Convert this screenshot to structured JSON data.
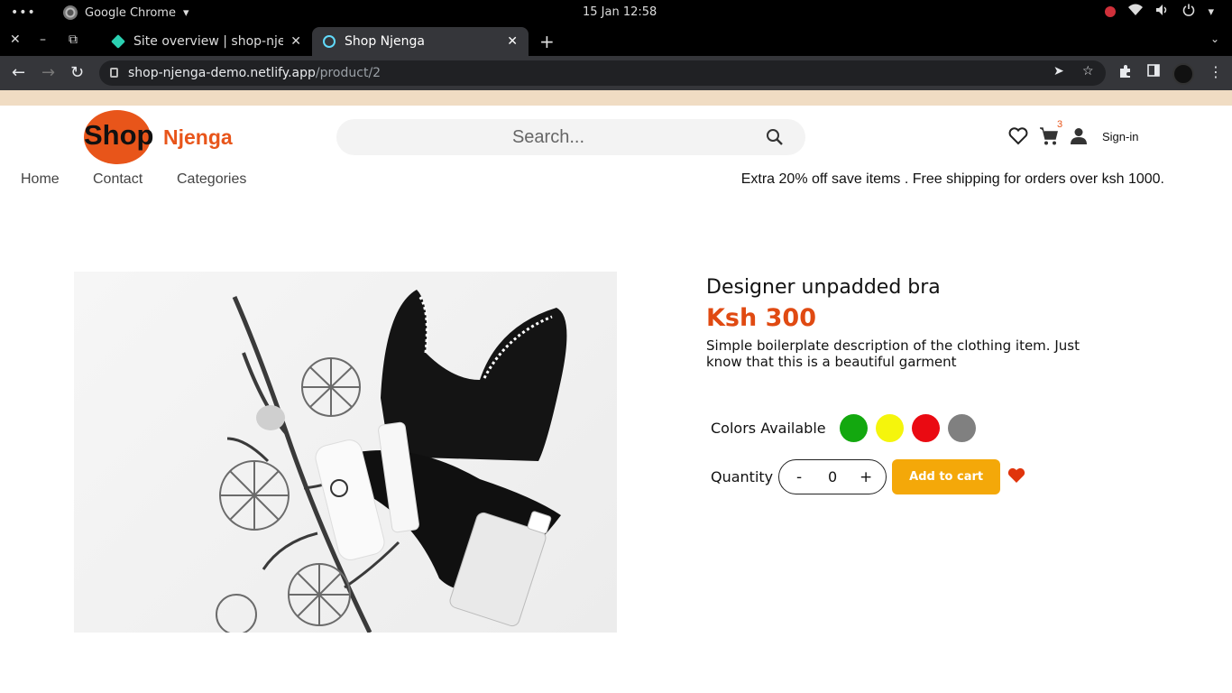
{
  "os": {
    "app_name": "Google Chrome",
    "clock": "15 Jan  12:58"
  },
  "browser": {
    "tabs": [
      {
        "title": "Site overview | shop-njenga",
        "active": false
      },
      {
        "title": "Shop Njenga",
        "active": true
      }
    ],
    "url_host": "shop-njenga-demo.netlify.app",
    "url_path": "/product/2"
  },
  "header": {
    "logo_shop": "Shop",
    "logo_brand": "Njenga",
    "search_placeholder": "Search...",
    "cart_count": "3",
    "signin_label": "Sign-in"
  },
  "nav": {
    "items": [
      "Home",
      "Contact",
      "Categories"
    ],
    "promo": "Extra 20% off save items . Free shipping for orders over ksh 1000."
  },
  "product": {
    "name": "Designer unpadded bra",
    "price": "Ksh 300",
    "description": "Simple boilerplate description of the clothing item. Just know that this is a beautiful garment",
    "colors_label": "Colors Available",
    "colors": [
      "#13a80f",
      "#f5f50c",
      "#ea0a12",
      "#808080"
    ],
    "quantity_label": "Quantity",
    "quantity_value": "0",
    "decrement": "-",
    "increment": "+",
    "add_to_cart": "Add to cart"
  },
  "colors": {
    "accent": "#e8551a",
    "price": "#e04a12",
    "button": "#f4a809",
    "heart": "#e0340c"
  }
}
